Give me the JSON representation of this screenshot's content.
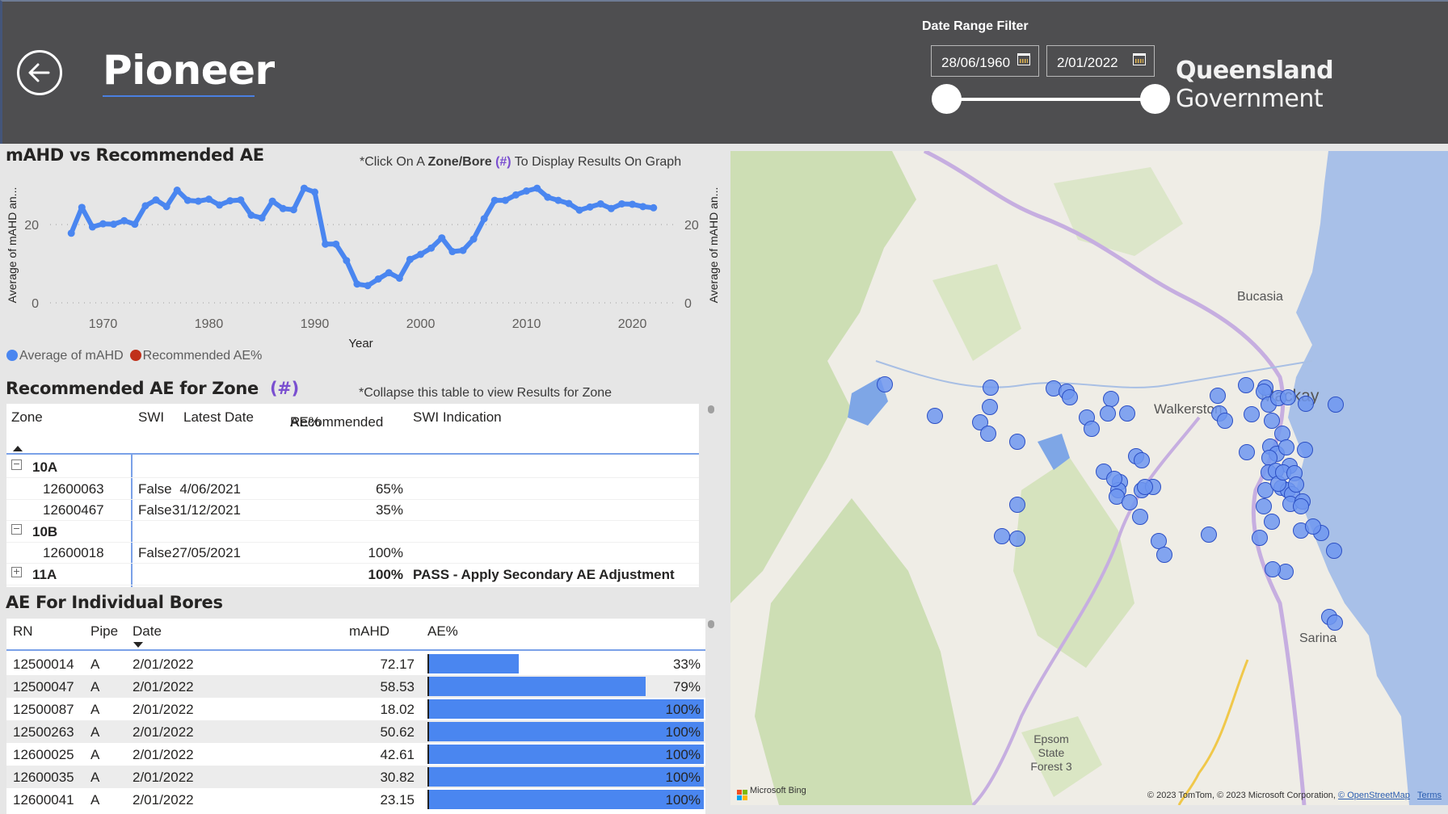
{
  "header": {
    "title": "Pioneer",
    "date_filter_label": "Date Range Filter",
    "start_date": "28/06/1960",
    "end_date": "2/01/2022",
    "slider_range": {
      "start_fraction": 0.0,
      "end_fraction": 1.0
    },
    "logo_bold": "Queensland",
    "logo_light": " Government"
  },
  "chart_section": {
    "title": "mAHD vs Recommended AE",
    "hint_prefix": "*Click On A ",
    "hint_bold": "Zone/Bore",
    "hint_hash": "(#)",
    "hint_suffix": " To Display Results On Graph"
  },
  "chart_data": {
    "type": "line",
    "title": "mAHD vs Recommended AE",
    "xlabel": "Year",
    "ylabel_left": "Average of mAHD an...",
    "ylabel_right": "Average of mAHD an...",
    "xlim": [
      1965,
      2024
    ],
    "ylim": [
      0,
      32
    ],
    "x_ticks": [
      1970,
      1980,
      1990,
      2000,
      2010,
      2020
    ],
    "y_ticks_left": [
      0,
      20
    ],
    "y_ticks_right": [
      0,
      20
    ],
    "grid": true,
    "legend_position": "bottom-left",
    "series": [
      {
        "name": "Average of mAHD",
        "color": "#4a86f0",
        "x": [
          1967,
          1968,
          1969,
          1970,
          1971,
          1972,
          1973,
          1974,
          1975,
          1976,
          1977,
          1978,
          1979,
          1980,
          1981,
          1982,
          1983,
          1984,
          1985,
          1986,
          1987,
          1988,
          1989,
          1990,
          1991,
          1992,
          1993,
          1994,
          1995,
          1996,
          1997,
          1998,
          1999,
          2000,
          2001,
          2002,
          2003,
          2004,
          2005,
          2006,
          2007,
          2008,
          2009,
          2010,
          2011,
          2012,
          2013,
          2014,
          2015,
          2016,
          2017,
          2018,
          2019,
          2020,
          2021,
          2022
        ],
        "y": [
          17.8,
          24.4,
          19.4,
          20.2,
          20.1,
          21.0,
          20.1,
          24.8,
          26.3,
          24.6,
          28.8,
          26.2,
          26.0,
          26.5,
          25.0,
          26.1,
          26.3,
          22.4,
          21.7,
          26.0,
          24.1,
          23.8,
          29.3,
          28.3,
          15.0,
          15.0,
          10.8,
          4.8,
          4.4,
          6.1,
          7.7,
          6.3,
          11.1,
          12.4,
          14.0,
          16.6,
          13.1,
          13.4,
          16.3,
          21.5,
          26.2,
          26.2,
          27.6,
          28.6,
          29.3,
          27.0,
          26.2,
          25.4,
          23.7,
          24.5,
          25.3,
          24.1,
          25.3,
          25.2,
          24.6,
          24.3
        ]
      },
      {
        "name": "Recommended AE%",
        "color": "#c0301a",
        "x": [],
        "y": []
      }
    ]
  },
  "legend": [
    {
      "label": "Average of mAHD",
      "color": "#4a86f0"
    },
    {
      "label": "Recommended AE%",
      "color": "#c0301a"
    }
  ],
  "zone_section": {
    "title": "Recommended AE for Zone",
    "title_hash": "(#)",
    "hint": "*Collapse this table to view Results for Zone",
    "columns": [
      "Zone",
      "SWI",
      "Latest Date",
      "Recommended",
      "AE%",
      "SWI Indication"
    ],
    "rows": [
      {
        "type": "group",
        "expander": "−",
        "zone": "10A",
        "swi": "",
        "date": "",
        "ae": "",
        "indication": ""
      },
      {
        "type": "item",
        "zone": "12600063",
        "swi": "False",
        "date": "4/06/2021",
        "ae": "65%",
        "indication": ""
      },
      {
        "type": "item",
        "zone": "12600467",
        "swi": "False",
        "date": "31/12/2021",
        "ae": "35%",
        "indication": ""
      },
      {
        "type": "group",
        "expander": "−",
        "zone": "10B",
        "swi": "",
        "date": "",
        "ae": "",
        "indication": ""
      },
      {
        "type": "item",
        "zone": "12600018",
        "swi": "False",
        "date": "27/05/2021",
        "ae": "100%",
        "indication": ""
      },
      {
        "type": "group",
        "expander": "+",
        "zone": "11A",
        "swi": "",
        "date": "",
        "ae": "100%",
        "indication": "PASS - Apply Secondary AE Adjustment"
      }
    ]
  },
  "bores_section": {
    "title": "AE For Individual Bores",
    "columns": [
      "RN",
      "Pipe",
      "Date",
      "mAHD",
      "AE%"
    ],
    "rows": [
      {
        "rn": "12500014",
        "pipe": "A",
        "date": "2/01/2022",
        "mahd": "72.17",
        "ae_label": "33%",
        "ae": 0.33
      },
      {
        "rn": "12500047",
        "pipe": "A",
        "date": "2/01/2022",
        "mahd": "58.53",
        "ae_label": "79%",
        "ae": 0.79
      },
      {
        "rn": "12500087",
        "pipe": "A",
        "date": "2/01/2022",
        "mahd": "18.02",
        "ae_label": "100%",
        "ae": 1.0
      },
      {
        "rn": "12500263",
        "pipe": "A",
        "date": "2/01/2022",
        "mahd": "50.62",
        "ae_label": "100%",
        "ae": 1.0
      },
      {
        "rn": "12600025",
        "pipe": "A",
        "date": "2/01/2022",
        "mahd": "42.61",
        "ae_label": "100%",
        "ae": 1.0
      },
      {
        "rn": "12600035",
        "pipe": "A",
        "date": "2/01/2022",
        "mahd": "30.82",
        "ae_label": "100%",
        "ae": 1.0
      },
      {
        "rn": "12600041",
        "pipe": "A",
        "date": "2/01/2022",
        "mahd": "23.15",
        "ae_label": "100%",
        "ae": 1.0
      }
    ]
  },
  "map": {
    "place_labels": [
      "Bucasia",
      "Walkerston",
      "Mackay",
      "Sarina",
      "Epsom State Forest 3"
    ],
    "attribution_brand": "Microsoft Bing",
    "copyright": "© 2023 TomTom, © 2023 Microsoft Corporation, ",
    "osm_link": "© OpenStreetMap",
    "terms_link": "Terms",
    "marker_color": "#6e96f0",
    "marker_count": 62
  }
}
